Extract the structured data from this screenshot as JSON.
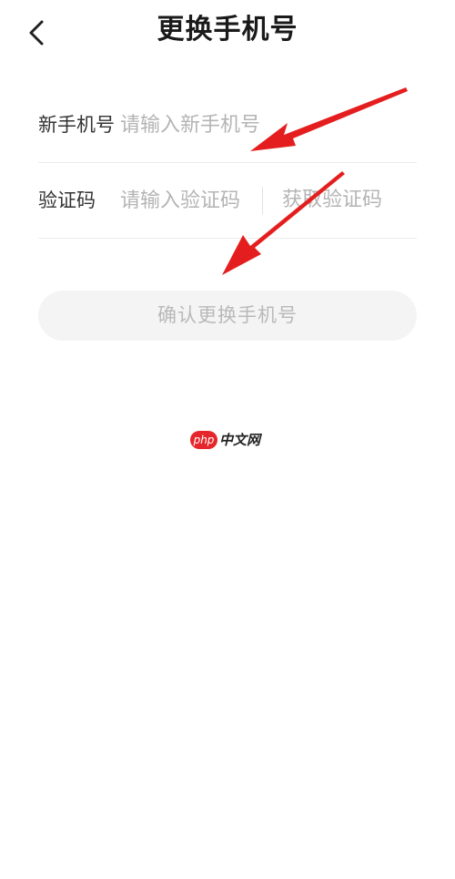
{
  "header": {
    "title": "更换手机号",
    "back_icon": "chevron-left-icon"
  },
  "form": {
    "phone": {
      "label": "新手机号",
      "placeholder": "请输入新手机号",
      "value": ""
    },
    "code": {
      "label": "验证码",
      "placeholder": "请输入验证码",
      "value": "",
      "get_code_label": "获取验证码"
    }
  },
  "confirm": {
    "label": "确认更换手机号"
  },
  "watermark": {
    "badge": "php",
    "text": "中文网"
  },
  "colors": {
    "annotation_arrow": "#e41e1e",
    "watermark_badge": "#e5262b",
    "placeholder": "#b4b4b4",
    "button_bg": "#f4f4f4"
  }
}
